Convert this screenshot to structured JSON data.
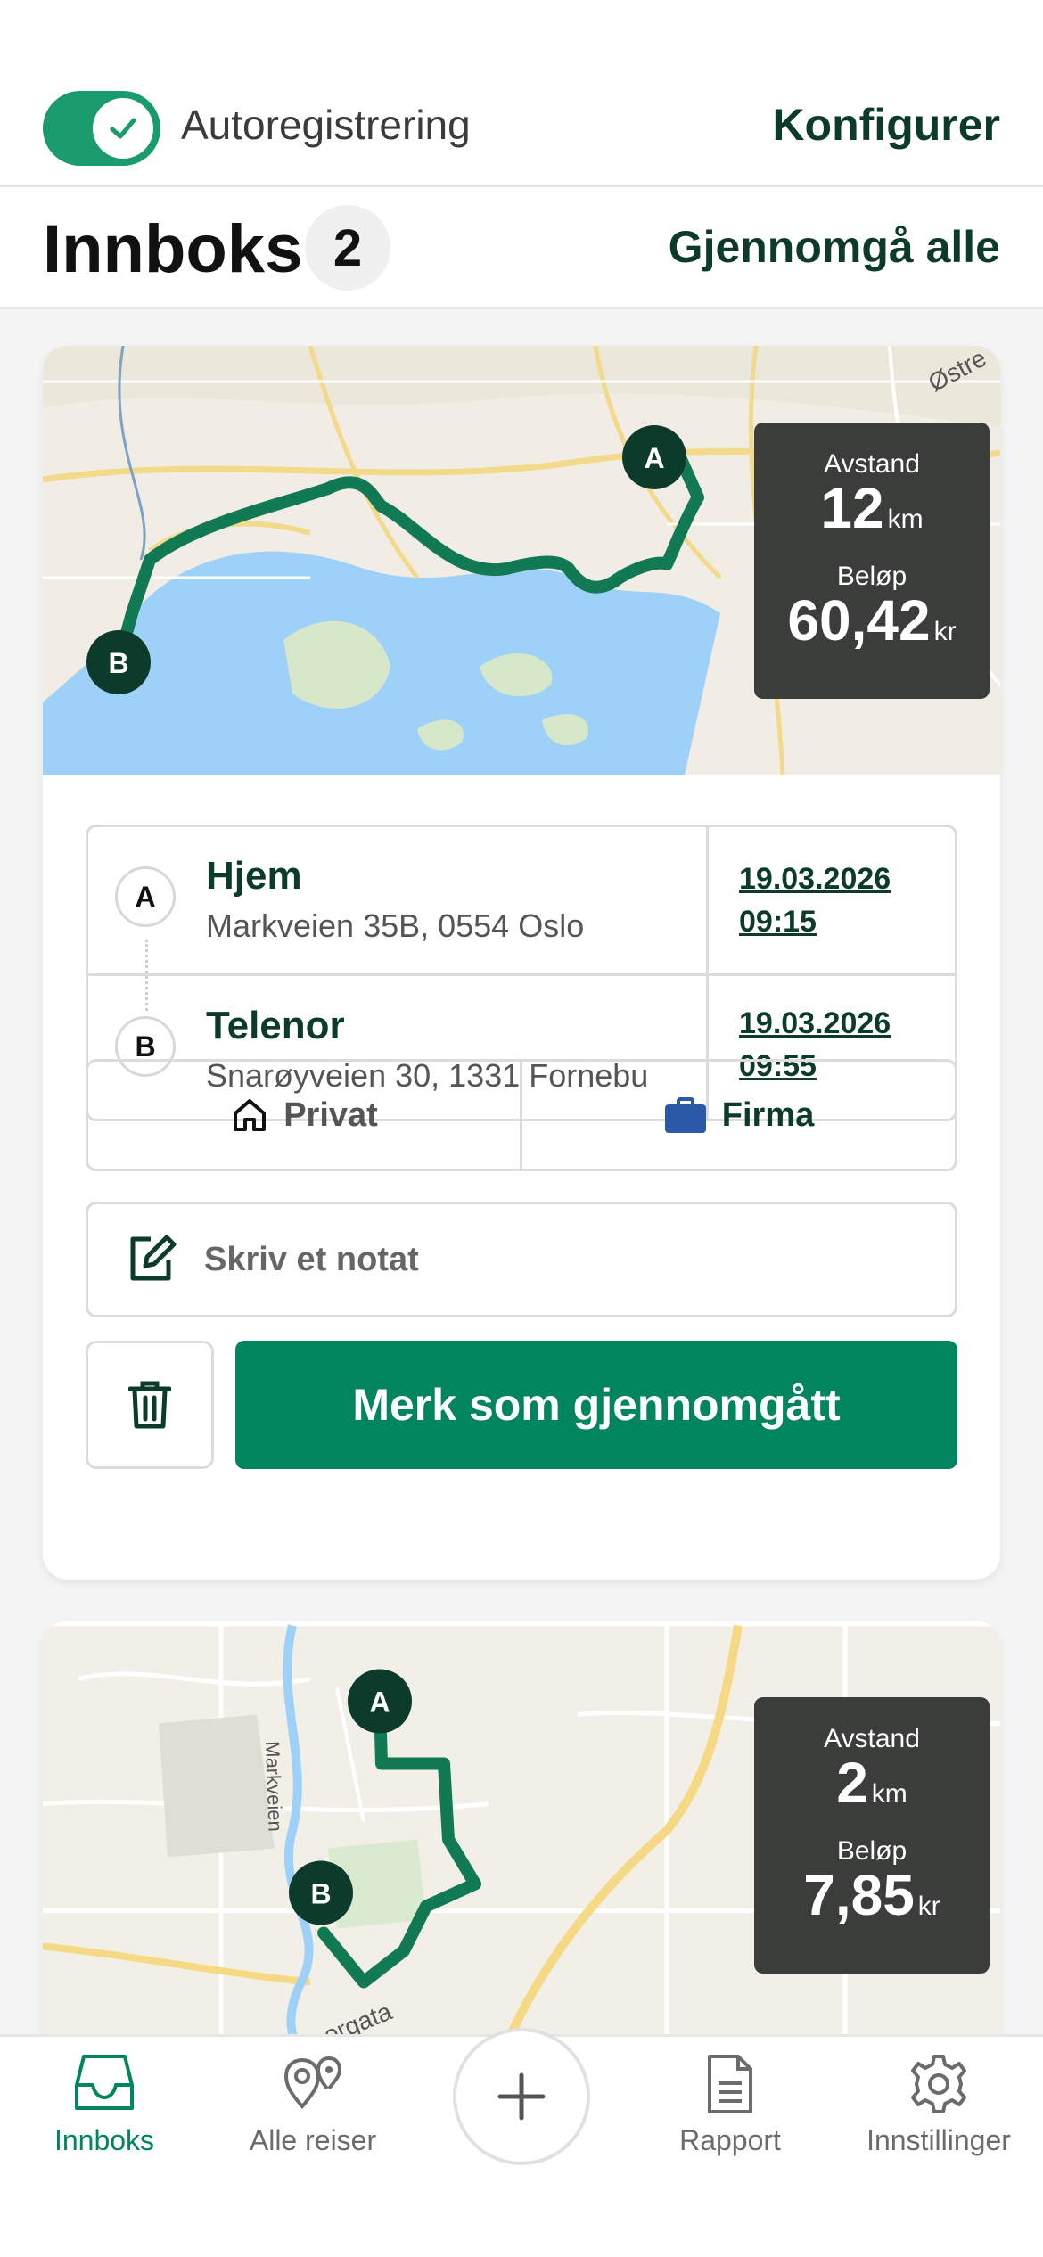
{
  "topbar": {
    "autoreg_label": "Autoregistrering",
    "autoreg_enabled": true,
    "configure_label": "Konfigurer"
  },
  "inbox": {
    "title": "Innboks",
    "count": "2",
    "review_all_label": "Gjennomgå alle"
  },
  "trips": [
    {
      "stats": {
        "distance_label": "Avstand",
        "distance_value": "12",
        "distance_unit": "km",
        "amount_label": "Beløp",
        "amount_value": "60,42",
        "amount_unit": "kr"
      },
      "map_labels": {
        "street": "Østre"
      },
      "start": {
        "marker": "A",
        "name": "Hjem",
        "address": "Markveien 35B, 0554 Oslo",
        "date": "19.03.2026",
        "time": "09:15"
      },
      "end": {
        "marker": "B",
        "name": "Telenor",
        "address": "Snarøyveien 30, 1331 Fornebu",
        "date": "19.03.2026",
        "time": "09:55"
      },
      "type_private_label": "Privat",
      "type_business_label": "Firma",
      "selected_type": "Firma",
      "note_placeholder": "Skriv et notat",
      "mark_reviewed_label": "Merk som gjennomgått"
    },
    {
      "stats": {
        "distance_label": "Avstand",
        "distance_value": "2",
        "distance_unit": "km",
        "amount_label": "Beløp",
        "amount_value": "7,85",
        "amount_unit": "kr"
      },
      "map_labels": {
        "street_a": "Markveien",
        "street_b": "orgata"
      },
      "start": {
        "marker": "A"
      },
      "end": {
        "marker": "B"
      }
    }
  ],
  "tabs": [
    {
      "label": "Innboks",
      "icon": "inbox-icon",
      "active": true
    },
    {
      "label": "Alle reiser",
      "icon": "map-pins-icon"
    },
    {
      "label": "",
      "icon": "plus-icon"
    },
    {
      "label": "Rapport",
      "icon": "document-icon"
    },
    {
      "label": "Innstillinger",
      "icon": "gear-icon"
    }
  ],
  "colors": {
    "brand_green": "#00855f",
    "dark_green": "#0c3b2c",
    "route": "#117a55",
    "water": "#9dd1f8",
    "land": "#f1ede4"
  }
}
